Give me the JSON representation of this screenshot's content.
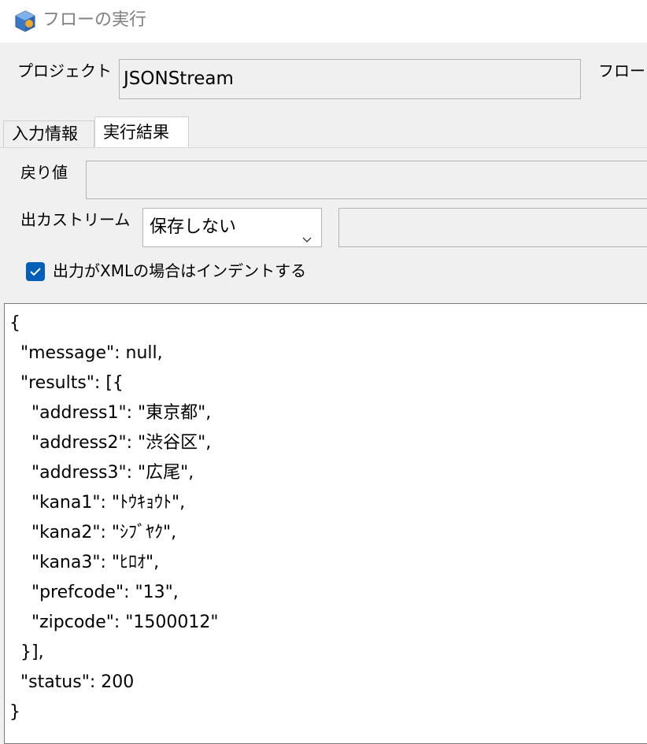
{
  "window": {
    "title": "フローの実行"
  },
  "form": {
    "project_label": "プロジェクト",
    "project_value": "JSONStream",
    "flow_label": "フロー"
  },
  "tabs": [
    {
      "label": "入力情報",
      "active": false
    },
    {
      "label": "実行結果",
      "active": true
    }
  ],
  "result": {
    "return_label": "戻り値",
    "return_value": "",
    "stream_label": "出カストリーム",
    "stream_select": "保存しない",
    "stream_value": "",
    "indent_label": "出力がXMLの場合はインデントする",
    "indent_checked": true
  },
  "output_lines": [
    "{",
    "  \"message\": null,",
    "  \"results\": [{",
    "    \"address1\": \"東京都\",",
    "    \"address2\": \"渋谷区\",",
    "    \"address3\": \"広尾\",",
    "    \"kana1\": \"ﾄｳｷｮｳﾄ\",",
    "    \"kana2\": \"ｼﾌﾞﾔｸ\",",
    "    \"kana3\": \"ﾋﾛｵ\",",
    "    \"prefcode\": \"13\",",
    "    \"zipcode\": \"1500012\"",
    "  }],",
    "  \"status\": 200",
    "}"
  ],
  "colors": {
    "accent": "#005fb8",
    "window_bg": "#f0f0f0"
  },
  "icons": {
    "app": "app-cube-icon",
    "dropdown": "chevron-down-icon",
    "check": "check-icon"
  }
}
